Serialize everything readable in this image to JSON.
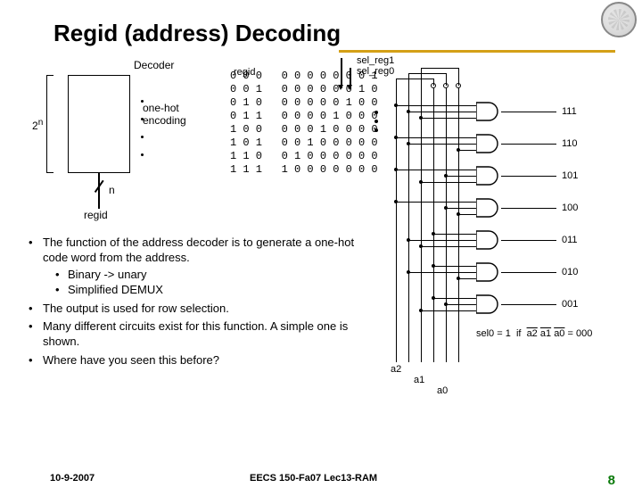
{
  "title": "Regid (address) Decoding",
  "decoder_fig": {
    "label_decoder": "Decoder",
    "label_2n": "2",
    "label_2n_sup": "n",
    "label_onehot1": "one-hot",
    "label_onehot2": "encoding",
    "label_n": "n",
    "label_regid": "regid"
  },
  "selreg": {
    "sel1": "sel_reg1",
    "sel0": "sel_reg0"
  },
  "truth_table": {
    "header": "regid",
    "rows": [
      "0 0 0   0 0 0 0 0 0 0 1",
      "0 0 1   0 0 0 0 0 0 1 0",
      "0 1 0   0 0 0 0 0 1 0 0",
      "0 1 1   0 0 0 0 1 0 0 0",
      "1 0 0   0 0 0 1 0 0 0 0",
      "1 0 1   0 0 1 0 0 0 0 0",
      "1 1 0   0 1 0 0 0 0 0 0",
      "1 1 1   1 0 0 0 0 0 0 0"
    ]
  },
  "circuit": {
    "outputs": [
      "111",
      "110",
      "101",
      "100",
      "011",
      "010",
      "001"
    ],
    "sel0_note": "sel0 = 1  if  a2 a1 a0 = 000",
    "inputs": [
      "a2",
      "a1",
      "a0"
    ],
    "overbar_inputs": [
      "a2",
      "a1",
      "a0"
    ]
  },
  "bullets": {
    "b1": "The function of the address decoder is to generate a one-hot code word from the address.",
    "b1a": "Binary -> unary",
    "b1b": "Simplified DEMUX",
    "b2": "The output is used for row selection.",
    "b3": "Many different circuits exist for this function.  A simple one is shown.",
    "b4": "Where have you seen this before?"
  },
  "footer": {
    "date": "10-9-2007",
    "course": "EECS 150-Fa07 Lec13-RAM",
    "page": "8"
  }
}
